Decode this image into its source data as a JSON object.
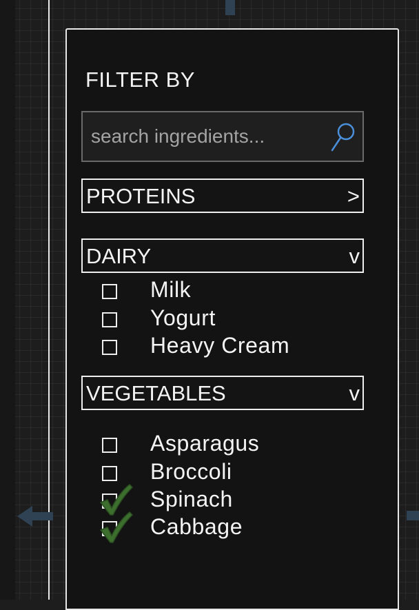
{
  "filter": {
    "title": "FILTER BY",
    "search_placeholder": "search ingredients...",
    "search_value": ""
  },
  "sections": [
    {
      "label": "PROTEINS",
      "chevron": ">",
      "expanded": false
    },
    {
      "label": "DAIRY",
      "chevron": "v",
      "expanded": true
    },
    {
      "label": "VEGETABLES",
      "chevron": "v",
      "expanded": true
    }
  ],
  "dairy_items": [
    {
      "label": "Milk",
      "checked": false
    },
    {
      "label": "Yogurt",
      "checked": false
    },
    {
      "label": "Heavy Cream",
      "checked": false
    }
  ],
  "vegetable_items": [
    {
      "label": "Asparagus",
      "checked": false
    },
    {
      "label": "Broccoli",
      "checked": false
    },
    {
      "label": "Spinach",
      "checked": true
    },
    {
      "label": "Cabbage",
      "checked": true
    }
  ],
  "icons": {
    "search": "search-icon",
    "check": "check-mark-icon",
    "arrow_left": "arrow-left-icon"
  },
  "colors": {
    "accent_blue": "#4a8fd9",
    "check_green": "#3c6e2e",
    "line": "#e9e9e9"
  }
}
